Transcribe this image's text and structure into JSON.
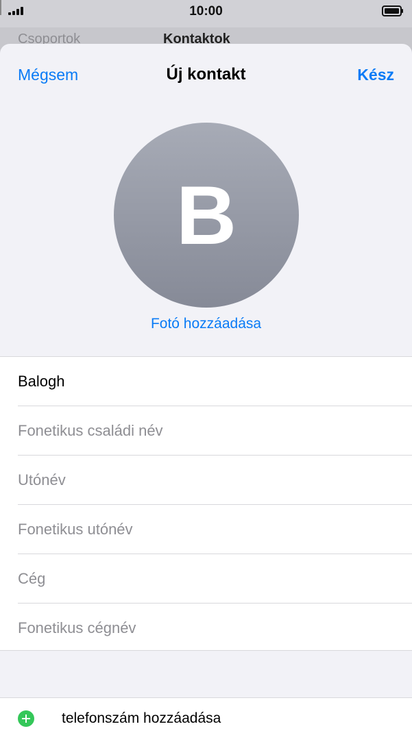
{
  "status_bar": {
    "time": "10:00"
  },
  "background_nav": {
    "left": "Csoportok",
    "title": "Kontaktok"
  },
  "nav": {
    "cancel": "Mégsem",
    "title": "Új kontakt",
    "done": "Kész"
  },
  "avatar": {
    "initial": "B",
    "add_photo": "Fotó hozzáadása"
  },
  "fields": [
    {
      "text": "Balogh",
      "placeholder": false
    },
    {
      "text": "Fonetikus családi név",
      "placeholder": true
    },
    {
      "text": "Utónév",
      "placeholder": true
    },
    {
      "text": "Fonetikus utónév",
      "placeholder": true
    },
    {
      "text": "Cég",
      "placeholder": true
    },
    {
      "text": "Fonetikus cégnév",
      "placeholder": true
    }
  ],
  "add_phone": {
    "label": "telefonszám hozzáadása"
  },
  "colors": {
    "accent": "#0a7bf6",
    "add": "#34c759"
  }
}
